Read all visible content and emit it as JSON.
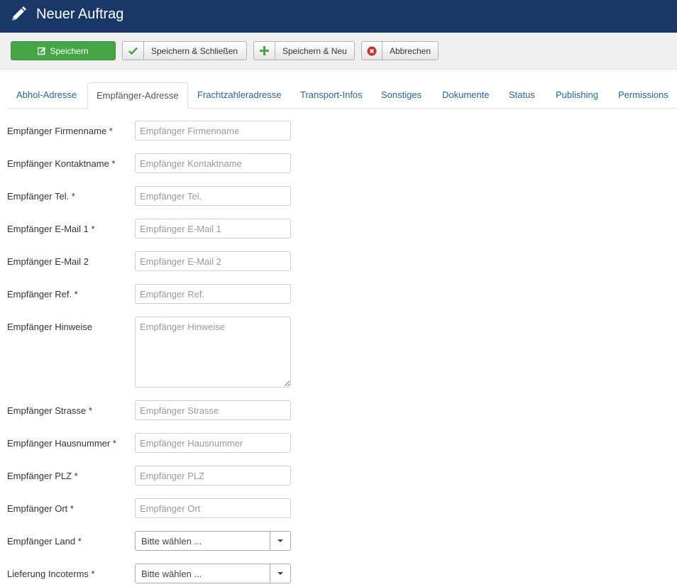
{
  "header": {
    "title": "Neuer Auftrag"
  },
  "toolbar": {
    "save": "Speichern",
    "save_close": "Speichern & Schließen",
    "save_new": "Speichern & Neu",
    "cancel": "Abbrechen"
  },
  "tabs": [
    {
      "label": "Abhol-Adresse"
    },
    {
      "label": "Empfänger-Adresse"
    },
    {
      "label": "Frachtzahleradresse"
    },
    {
      "label": "Transport-Infos"
    },
    {
      "label": "Sonstiges"
    },
    {
      "label": "Dokumente"
    },
    {
      "label": "Status"
    },
    {
      "label": "Publishing"
    },
    {
      "label": "Permissions"
    }
  ],
  "active_tab": "Empfänger-Adresse",
  "fields": {
    "firmenname": {
      "label": "Empfänger Firmenname *",
      "placeholder": "Empfänger Firmenname",
      "value": ""
    },
    "kontaktname": {
      "label": "Empfänger Kontaktname *",
      "placeholder": "Empfänger Kontaktname",
      "value": ""
    },
    "tel": {
      "label": "Empfänger Tel. *",
      "placeholder": "Empfänger Tel.",
      "value": ""
    },
    "email1": {
      "label": "Empfänger E-Mail 1 *",
      "placeholder": "Empfänger E-Mail 1",
      "value": ""
    },
    "email2": {
      "label": "Empfänger E-Mail 2",
      "placeholder": "Empfänger E-Mail 2",
      "value": ""
    },
    "ref": {
      "label": "Empfänger Ref. *",
      "placeholder": "Empfänger Ref.",
      "value": ""
    },
    "hinweise": {
      "label": "Empfänger Hinweise",
      "placeholder": "Empfänger Hinweise",
      "value": ""
    },
    "strasse": {
      "label": "Empfänger Strasse *",
      "placeholder": "Empfänger Strasse",
      "value": ""
    },
    "hausnummer": {
      "label": "Empfänger Hausnummer *",
      "placeholder": "Empfänger Hausnummer",
      "value": ""
    },
    "plz": {
      "label": "Empfänger PLZ *",
      "placeholder": "Empfänger PLZ",
      "value": ""
    },
    "ort": {
      "label": "Empfänger Ort *",
      "placeholder": "Empfänger Ort",
      "value": ""
    },
    "land": {
      "label": "Empfänger Land *",
      "selected": "Bitte wählen ..."
    },
    "incoterms": {
      "label": "Lieferung Incoterms *",
      "selected": "Bitte wählen ..."
    }
  },
  "colors": {
    "header_bg": "#1a3867",
    "save_green": "#46a546",
    "link_blue": "#2a6496",
    "cancel_red": "#bd362f"
  },
  "icons": {
    "header": "pencil-icon",
    "save": "edit-icon",
    "save_close": "checkmark-icon",
    "save_new": "plus-icon",
    "cancel": "cancel-circle-icon",
    "select": "caret-down-icon"
  }
}
